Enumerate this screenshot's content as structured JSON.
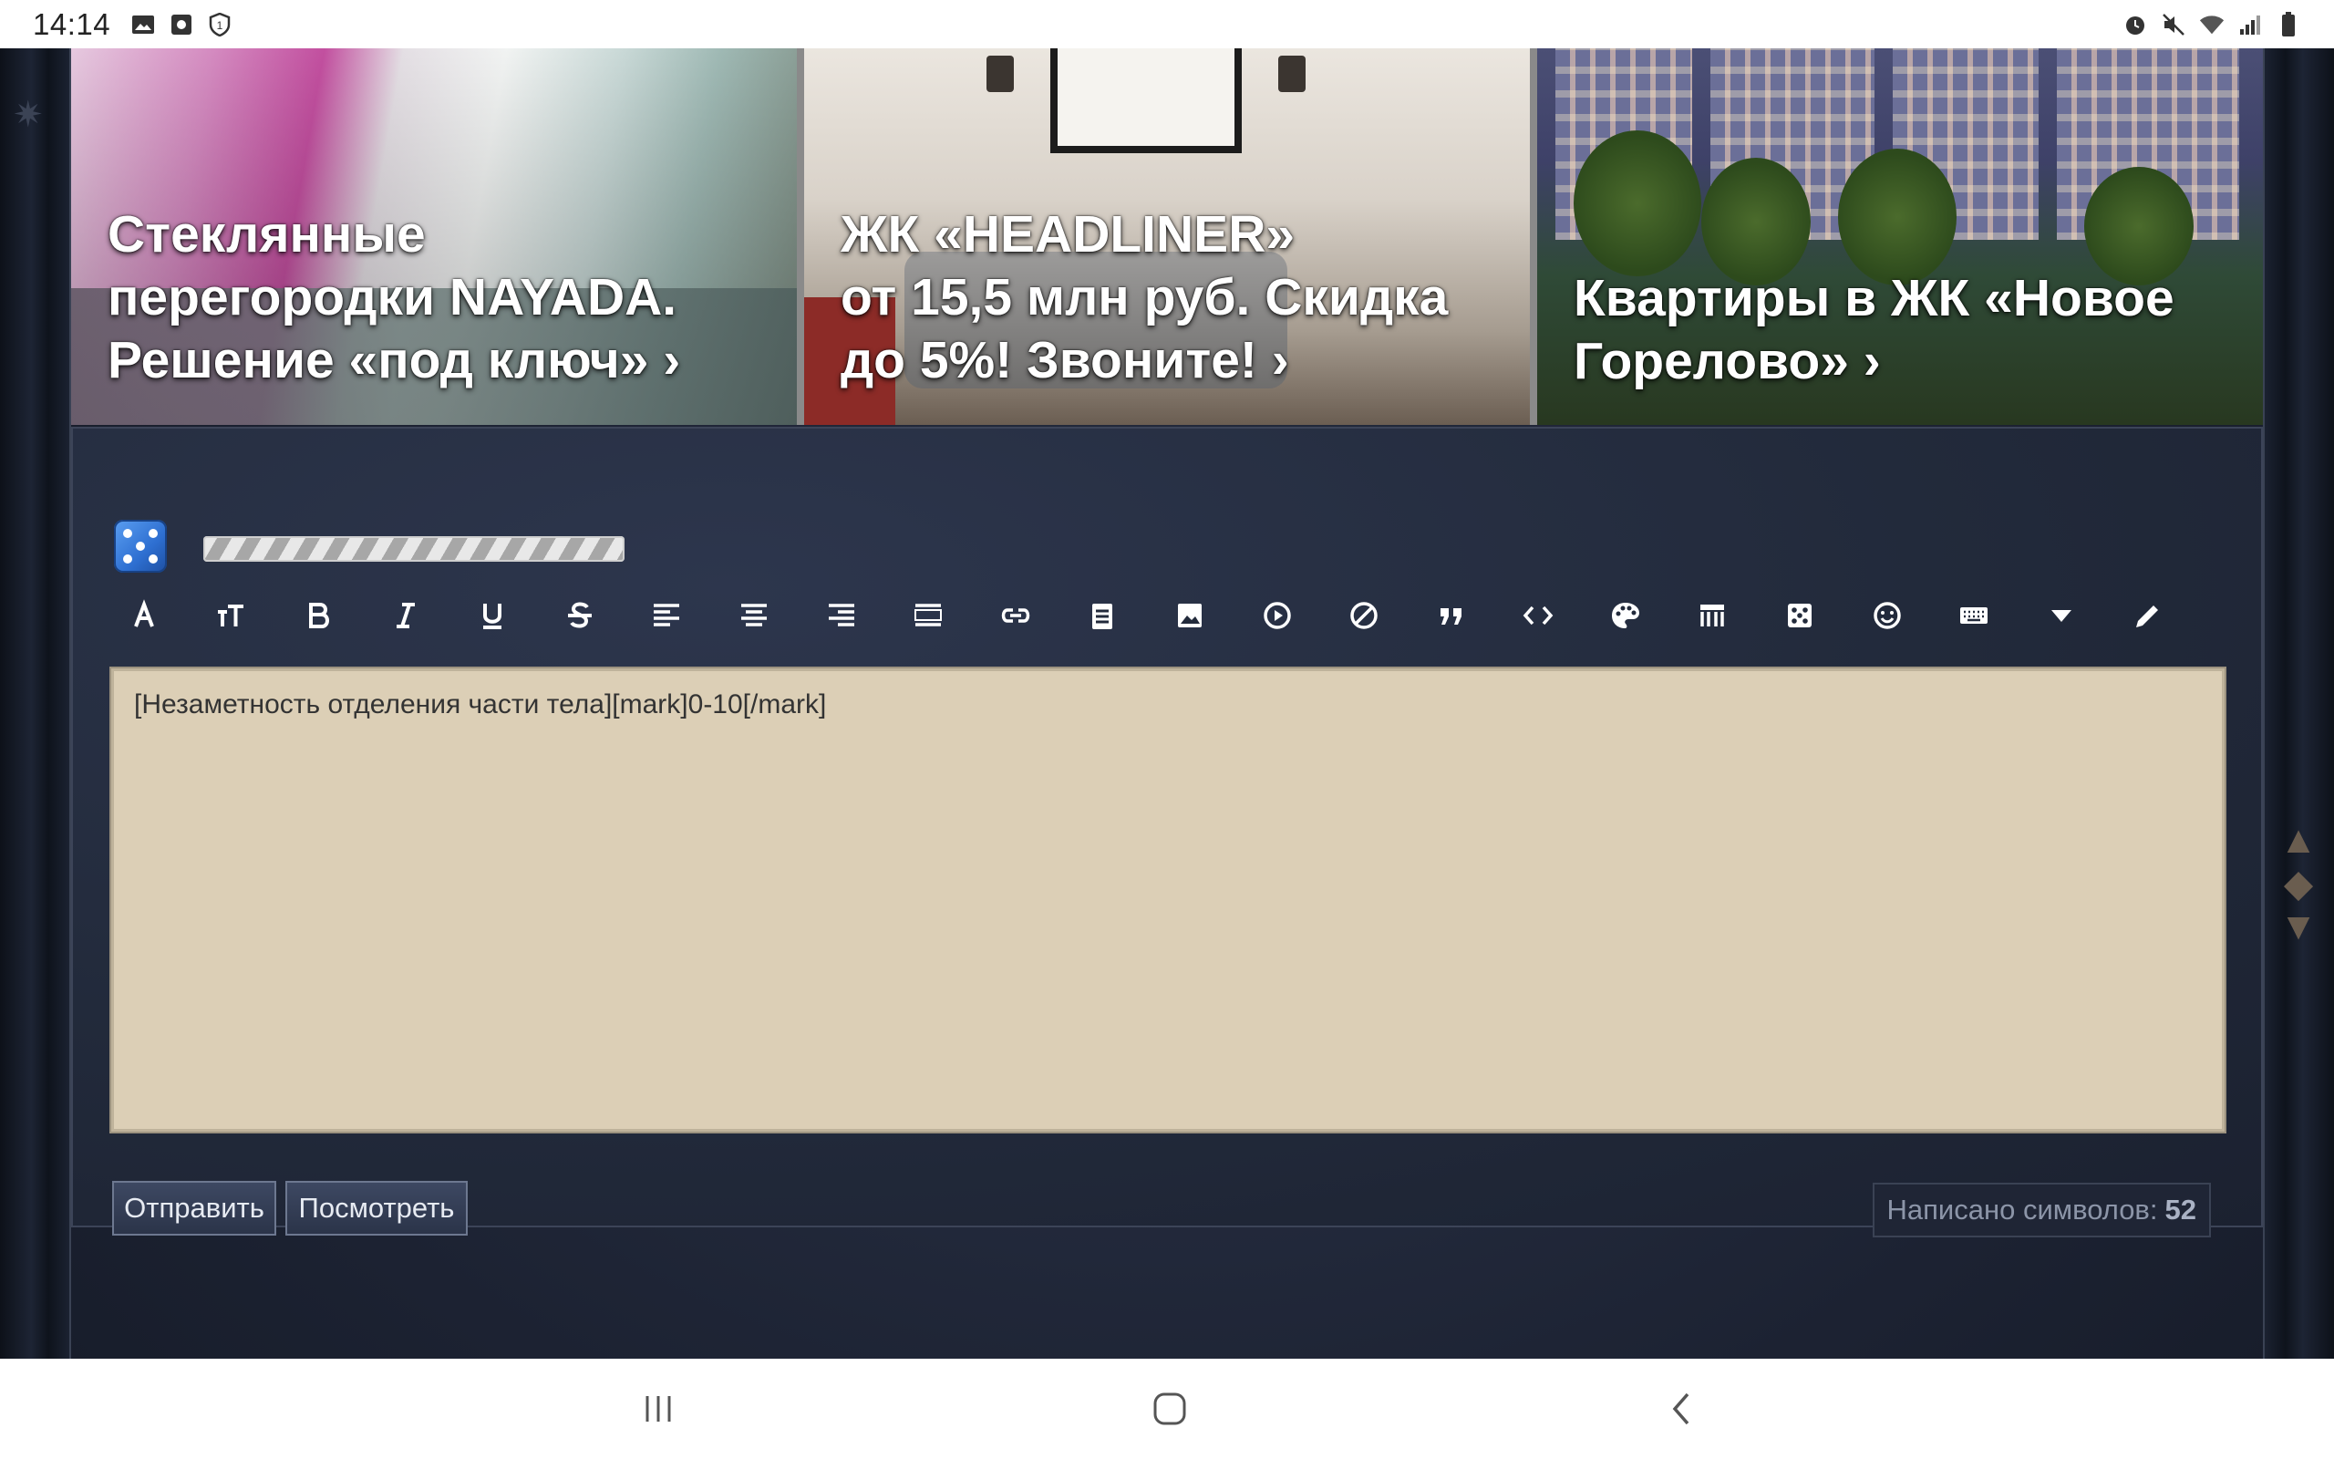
{
  "status_bar": {
    "time": "14:14",
    "left_icons": [
      "image-icon",
      "camera-app-icon",
      "vpn-shield-icon"
    ],
    "right_icons": [
      "alarm-icon",
      "mute-icon",
      "wifi-icon",
      "signal-icon",
      "battery-icon"
    ]
  },
  "ads": [
    {
      "text": "Стеклянные перегородки NAYADA. Решение «под ключ» ›",
      "lines": [
        "Стеклянные",
        "перегородки NAYADA.",
        "Решение «под ключ» ›"
      ]
    },
    {
      "text": "ЖК «HEADLINER» от 15,5 млн руб. Скидка до 5%! Звоните! ›",
      "lines": [
        "ЖК «HEADLINER»",
        "от 15,5 млн руб. Скидка",
        "до 5%! Звоните! ›"
      ]
    },
    {
      "text": "Квартиры в ЖК «Новое Горелово» ›",
      "lines": [
        "Квартиры в ЖК «Новое",
        "Горелово» ›"
      ]
    }
  ],
  "editor": {
    "toolbar": [
      "font-color-icon",
      "font-size-icon",
      "bold-icon",
      "italic-icon",
      "underline-icon",
      "strikethrough-icon",
      "align-left-icon",
      "align-center-icon",
      "align-right-icon",
      "justify-icon",
      "link-icon",
      "clipboard-icon",
      "image-icon",
      "video-icon",
      "no-entry-icon",
      "quote-icon",
      "code-icon",
      "palette-icon",
      "table-icon",
      "dice-icon",
      "smiley-icon",
      "keyboard-icon",
      "dropdown-icon",
      "pencil-icon"
    ],
    "content": "[Незаметность отделения части тела][mark]0-10[/mark]",
    "send_label": "Отправить",
    "preview_label": "Посмотреть",
    "counter_label": "Написано символов:",
    "counter_value": "52"
  },
  "colors": {
    "panel_bg": "#222a3b",
    "textarea_bg": "#dccfb6",
    "button_bg": "#2b3449",
    "dice_blue": "#2e6fd1"
  }
}
